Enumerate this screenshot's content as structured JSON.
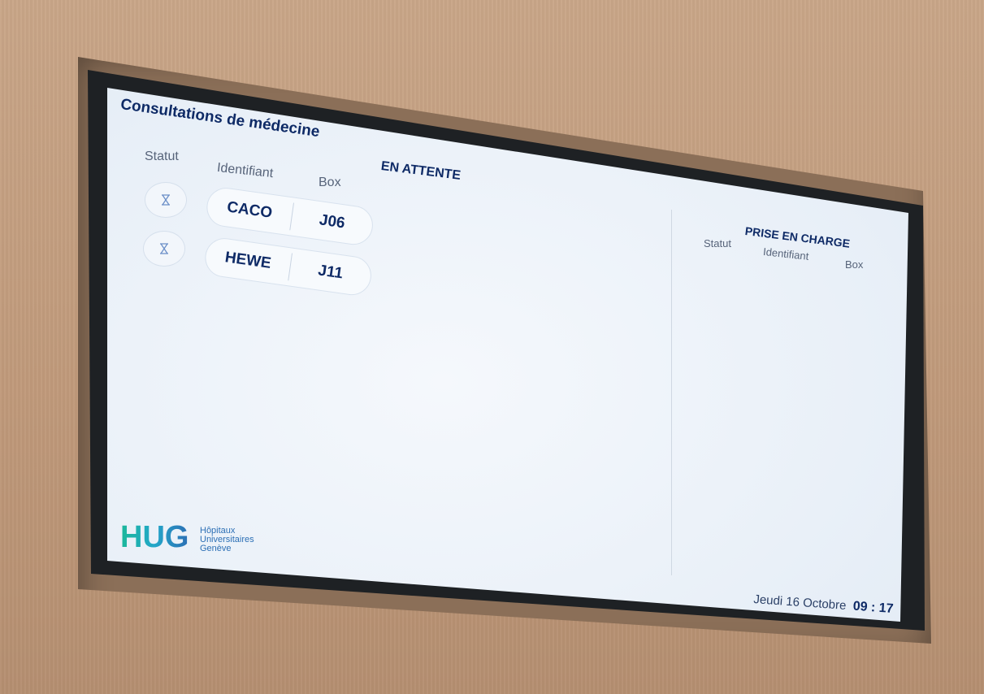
{
  "header": {
    "title": "Consultations de médecine"
  },
  "waiting": {
    "section_label": "EN ATTENTE",
    "col_status": "Statut",
    "col_id": "Identifiant",
    "col_box": "Box",
    "rows": [
      {
        "status_icon": "hourglass-icon",
        "id": "CACO",
        "box": "J06"
      },
      {
        "status_icon": "hourglass-icon",
        "id": "HEWE",
        "box": "J11"
      }
    ]
  },
  "in_care": {
    "section_label": "PRISE EN CHARGE",
    "col_status": "Statut",
    "col_id": "Identifiant",
    "col_box": "Box"
  },
  "logo": {
    "mark": "HUG",
    "line1": "Hôpitaux",
    "line2": "Universitaires",
    "line3": "Genève"
  },
  "footer": {
    "date": "Jeudi 16 Octobre",
    "time": "09 : 17"
  },
  "colors": {
    "text": "#0e2a66",
    "logo_green": "#1bb89a",
    "logo_blue": "#2c6fb5"
  }
}
